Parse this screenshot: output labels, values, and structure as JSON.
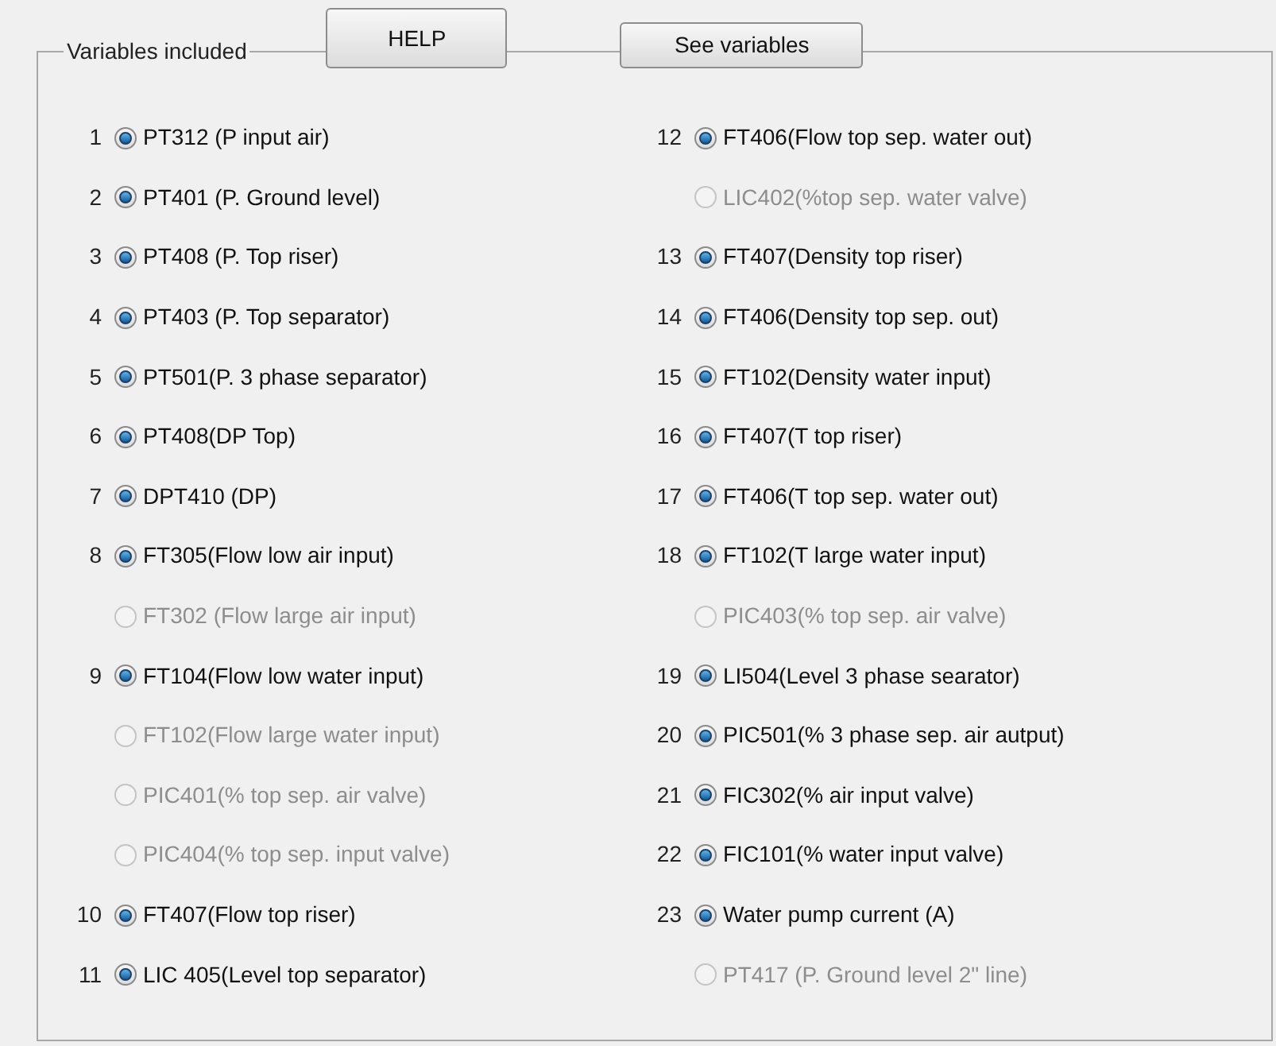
{
  "panel": {
    "title": "Variables included",
    "buttons": [
      "HELP",
      "See variables"
    ]
  },
  "columns": [
    {
      "items": [
        {
          "number": "1",
          "label": "PT312 (P input air)",
          "selected": true,
          "disabled": false
        },
        {
          "number": "2",
          "label": "PT401 (P. Ground level)",
          "selected": true,
          "disabled": false
        },
        {
          "number": "3",
          "label": "PT408 (P. Top riser)",
          "selected": true,
          "disabled": false
        },
        {
          "number": "4",
          "label": "PT403 (P. Top separator)",
          "selected": true,
          "disabled": false
        },
        {
          "number": "5",
          "label": "PT501(P. 3 phase separator)",
          "selected": true,
          "disabled": false
        },
        {
          "number": "6",
          "label": "PT408(DP Top)",
          "selected": true,
          "disabled": false
        },
        {
          "number": "7",
          "label": "DPT410 (DP)",
          "selected": true,
          "disabled": false
        },
        {
          "number": "8",
          "label": "FT305(Flow low air input)",
          "selected": true,
          "disabled": false
        },
        {
          "label": "FT302 (Flow large air input)",
          "selected": false,
          "disabled": true
        },
        {
          "number": "9",
          "label": "FT104(Flow low water input)",
          "selected": true,
          "disabled": false
        },
        {
          "label": "FT102(Flow large water input)",
          "selected": false,
          "disabled": true
        },
        {
          "label": "PIC401(% top sep. air valve)",
          "selected": false,
          "disabled": true
        },
        {
          "label": "PIC404(% top sep. input valve)",
          "selected": false,
          "disabled": true
        },
        {
          "number": "10",
          "label": "FT407(Flow top riser)",
          "selected": true,
          "disabled": false
        },
        {
          "number": "11",
          "label": "LIC 405(Level top separator)",
          "selected": true,
          "disabled": false
        }
      ]
    },
    {
      "items": [
        {
          "number": "12",
          "label": "FT406(Flow top sep. water out)",
          "selected": true,
          "disabled": false
        },
        {
          "label": "LIC402(%top sep. water valve)",
          "selected": false,
          "disabled": true
        },
        {
          "number": "13",
          "label": "FT407(Density top riser)",
          "selected": true,
          "disabled": false
        },
        {
          "number": "14",
          "label": "FT406(Density top sep. out)",
          "selected": true,
          "disabled": false
        },
        {
          "number": "15",
          "label": "FT102(Density water input)",
          "selected": true,
          "disabled": false
        },
        {
          "number": "16",
          "label": "FT407(T top riser)",
          "selected": true,
          "disabled": false
        },
        {
          "number": "17",
          "label": "FT406(T top sep. water out)",
          "selected": true,
          "disabled": false
        },
        {
          "number": "18",
          "label": "FT102(T large water input)",
          "selected": true,
          "disabled": false
        },
        {
          "label": "PIC403(% top sep. air valve)",
          "selected": false,
          "disabled": true
        },
        {
          "number": "19",
          "label": "LI504(Level 3 phase searator)",
          "selected": true,
          "disabled": false
        },
        {
          "number": "20",
          "label": "PIC501(% 3 phase sep. air autput)",
          "selected": true,
          "disabled": false
        },
        {
          "number": "21",
          "label": "FIC302(% air input valve)",
          "selected": true,
          "disabled": false
        },
        {
          "number": "22",
          "label": "FIC101(% water input valve)",
          "selected": true,
          "disabled": false
        },
        {
          "number": "23",
          "label": "Water pump current (A)",
          "selected": true,
          "disabled": false
        },
        {
          "label": "PT417 (P. Ground level 2\" line)",
          "selected": false,
          "disabled": true
        }
      ]
    }
  ]
}
